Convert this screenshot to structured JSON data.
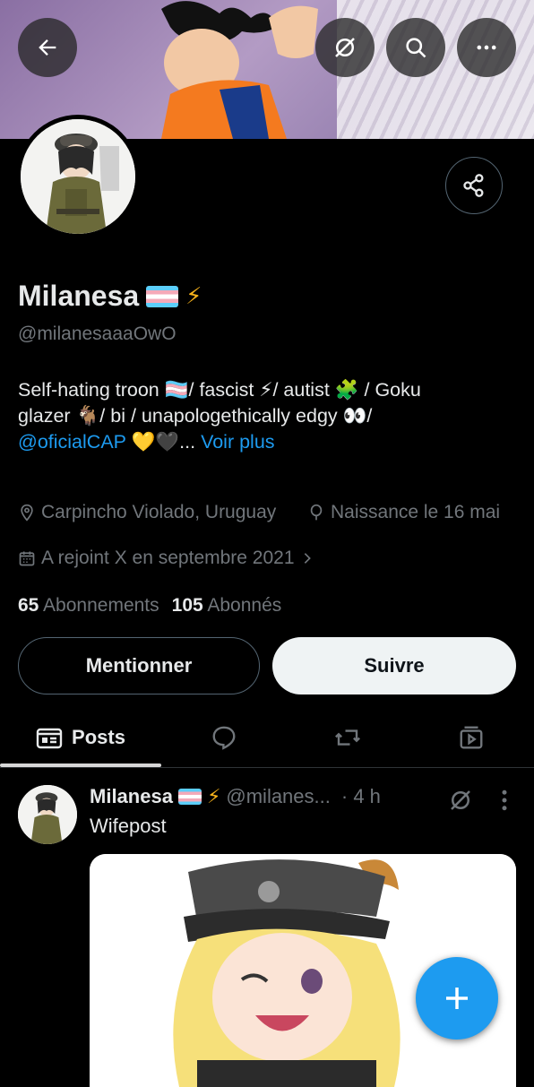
{
  "header": {
    "back_icon": "arrow-left-icon",
    "buttons": [
      "grok-icon",
      "search-icon",
      "more-icon"
    ]
  },
  "profile": {
    "name": "Milanesa",
    "name_emojis": [
      "🏳️‍⚧️",
      "⚡"
    ],
    "handle": "@milanesaaaOwO",
    "bio": {
      "line1": "Self-hating troon 🏳️‍⚧️/ fascist ⚡/ autist 🧩 / Goku",
      "line2": "glazer 🐐/ bi / unapologethically edgy 👀/",
      "mention": "@oficialCAP",
      "mention_emojis": "💛🖤...",
      "more": "Voir plus"
    },
    "location": "Carpincho Violado, Uruguay",
    "birthday": "Naissance le 16 mai",
    "joined": "A rejoint X en septembre 2021",
    "following_count": "65",
    "following_label": "Abonnements",
    "followers_count": "105",
    "followers_label": "Abonnés"
  },
  "actions": {
    "mention_label": "Mentionner",
    "follow_label": "Suivre"
  },
  "tabs": {
    "posts_label": "Posts"
  },
  "post": {
    "author": "Milanesa",
    "handle": "@milanes...",
    "time": "· 4 h",
    "text": "Wifepost"
  },
  "colors": {
    "accent": "#1d9bf0",
    "background": "#000000",
    "muted": "#71767b"
  }
}
